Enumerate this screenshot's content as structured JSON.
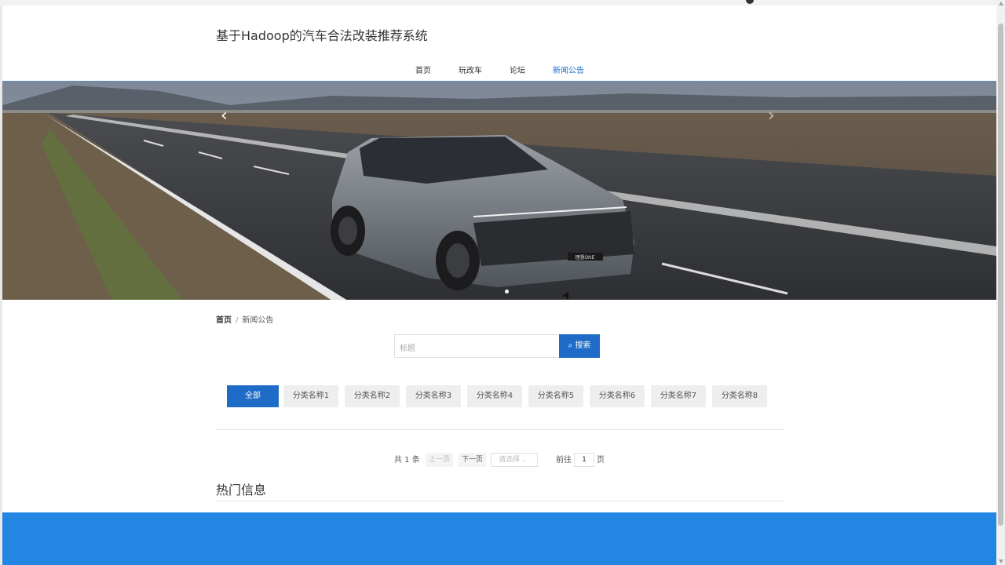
{
  "site": {
    "title": "基于Hadoop的汽车合法改装推荐系统"
  },
  "nav": {
    "items": [
      {
        "label": "首页",
        "active": false
      },
      {
        "label": "玩改车",
        "active": false
      },
      {
        "label": "论坛",
        "active": false
      },
      {
        "label": "新闻公告",
        "active": true
      }
    ]
  },
  "banner": {
    "plate_text": "理想ONE",
    "prev_icon": "chevron-left-icon",
    "next_icon": "chevron-right-icon",
    "active_slide": 1
  },
  "breadcrumb": {
    "home": "首页",
    "separator": "/",
    "current": "新闻公告"
  },
  "search": {
    "placeholder": "标题",
    "button_label": "搜索",
    "button_icon": "search-icon"
  },
  "categories": [
    {
      "label": "全部",
      "active": true
    },
    {
      "label": "分类名称1",
      "active": false
    },
    {
      "label": "分类名称2",
      "active": false
    },
    {
      "label": "分类名称3",
      "active": false
    },
    {
      "label": "分类名称4",
      "active": false
    },
    {
      "label": "分类名称5",
      "active": false
    },
    {
      "label": "分类名称6",
      "active": false
    },
    {
      "label": "分类名称7",
      "active": false
    },
    {
      "label": "分类名称8",
      "active": false
    }
  ],
  "pagination": {
    "total": "共 1 条",
    "prev": "上一页",
    "next": "下一页",
    "page_size_placeholder": "请选择",
    "goto_prefix": "前往",
    "goto_value": "1",
    "goto_suffix": "页"
  },
  "hot": {
    "title": "热门信息"
  },
  "colors": {
    "primary": "#1e6cc7",
    "footer": "#2386e3"
  }
}
